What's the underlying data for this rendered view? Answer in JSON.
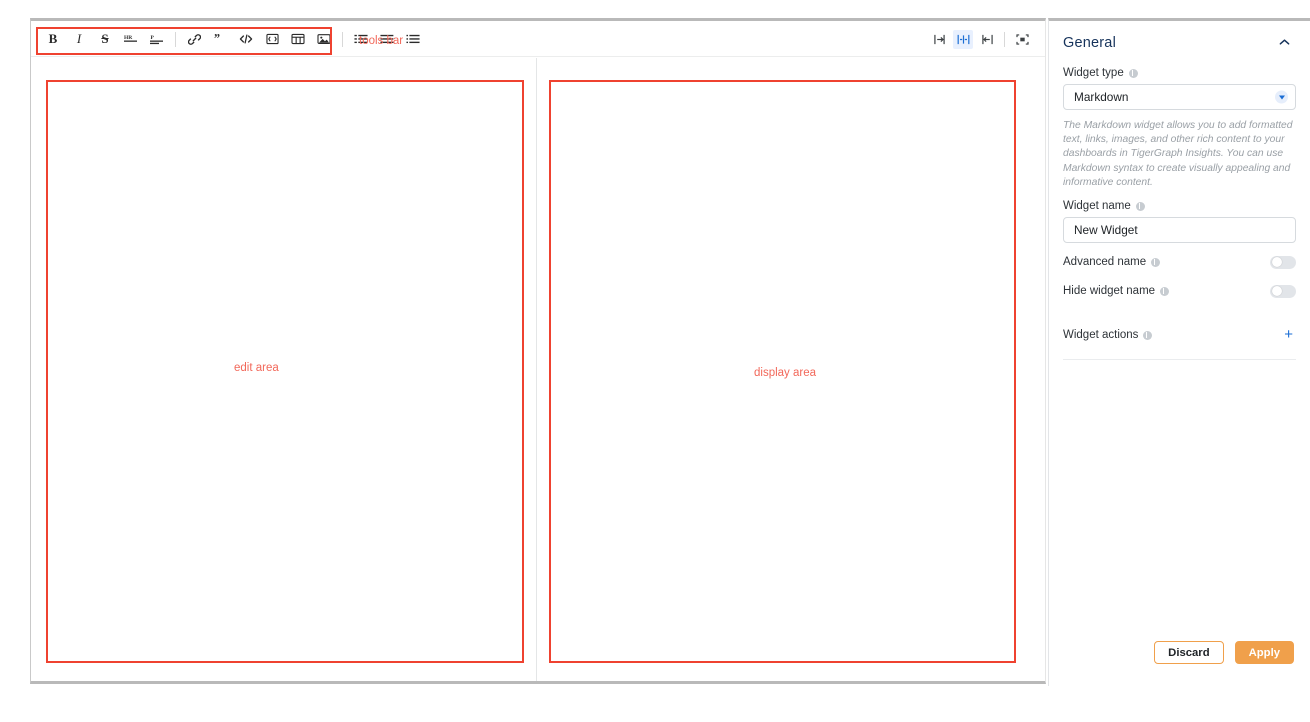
{
  "editor": {
    "toolbar": {
      "buttons": [
        {
          "name": "bold",
          "glyph": "B"
        },
        {
          "name": "italic",
          "glyph": "I"
        },
        {
          "name": "strikethrough",
          "glyph": "S"
        },
        {
          "name": "heading",
          "glyph": "HR"
        },
        {
          "name": "paragraph",
          "glyph": "P"
        },
        {
          "name": "link",
          "glyph": "link"
        },
        {
          "name": "quote",
          "glyph": "”"
        },
        {
          "name": "code",
          "glyph": "</>"
        },
        {
          "name": "code-block",
          "glyph": "[=]"
        },
        {
          "name": "table",
          "glyph": "table"
        },
        {
          "name": "image",
          "glyph": "image"
        },
        {
          "name": "ordered-list",
          "glyph": "ol"
        },
        {
          "name": "unordered-list",
          "glyph": "ul"
        },
        {
          "name": "task-list",
          "glyph": "tl"
        }
      ],
      "view_modes": [
        {
          "name": "editor-only",
          "active": false
        },
        {
          "name": "split-view",
          "active": true
        },
        {
          "name": "preview-only",
          "active": false
        },
        {
          "name": "fullscreen",
          "active": false
        }
      ]
    },
    "annotations": {
      "toolbar_label": "tools bar",
      "edit_label": "edit area",
      "display_label": "display area",
      "color": "#ef4230"
    },
    "edit_pane": {
      "content": ""
    },
    "display_pane": {
      "content": ""
    }
  },
  "settings": {
    "section_title": "General",
    "collapse_icon": "chevron-up",
    "widget_type": {
      "label": "Widget type",
      "value": "Markdown",
      "options": [
        "Markdown"
      ]
    },
    "description": "The Markdown widget allows you to add formatted text, links, images, and other rich content to your dashboards in TigerGraph Insights. You can use Markdown syntax to create visually appealing and informative content.",
    "widget_name": {
      "label": "Widget name",
      "value": "New Widget",
      "placeholder": "New Widget"
    },
    "advanced_name": {
      "label": "Advanced name",
      "enabled": false
    },
    "hide_widget_name": {
      "label": "Hide widget name",
      "enabled": false
    },
    "widget_actions": {
      "label": "Widget actions",
      "add_icon": "+"
    },
    "footer": {
      "discard_label": "Discard",
      "apply_label": "Apply",
      "accent_color": "#f0a04b"
    }
  }
}
